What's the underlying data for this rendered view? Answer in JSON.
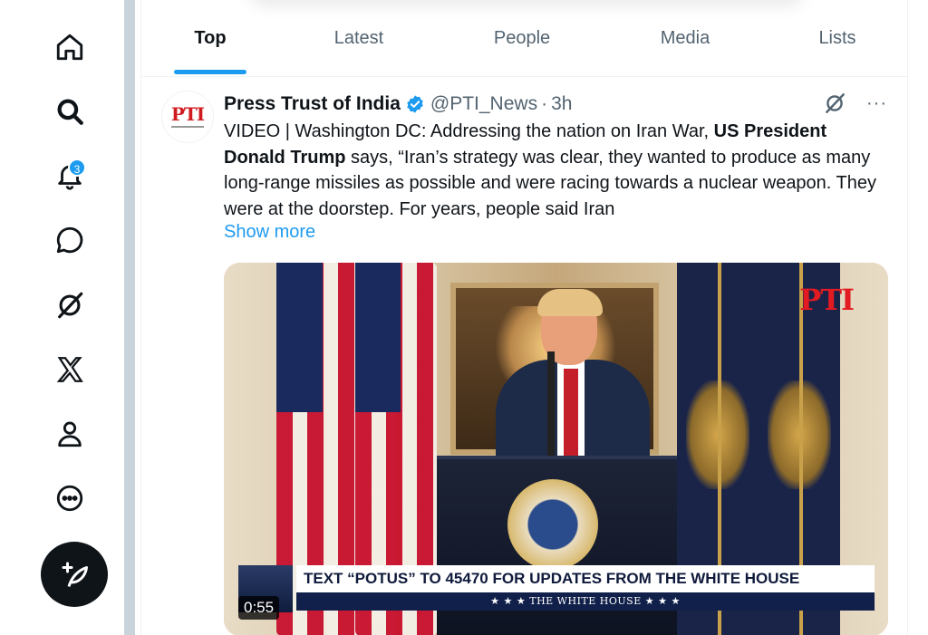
{
  "nav": {
    "notifications_badge": "3"
  },
  "tabs": [
    {
      "label": "Top"
    },
    {
      "label": "Latest"
    },
    {
      "label": "People"
    },
    {
      "label": "Media"
    },
    {
      "label": "Lists"
    }
  ],
  "tweet": {
    "author_name": "Press Trust of India",
    "handle": "@PTI_News",
    "separator": "·",
    "time": "3h",
    "more": "···",
    "avatar_text": "PTI",
    "text_part1": "VIDEO | Washington DC: Addressing the nation on Iran War, ",
    "text_bold": "US President Donald Trump",
    "text_part2": " says, “Iran’s strategy was clear, they wanted to produce as many long-range missiles as possible and were racing towards a nuclear weapon. They were at the doorstep. For years, people said Iran",
    "show_more": "Show more",
    "media": {
      "watermark": "PTI",
      "lower_third_top": "TEXT “POTUS” TO 45470 FOR UPDATES FROM THE WHITE HOUSE",
      "lower_third_bottom": "★ ★ ★   THE WHITE HOUSE   ★ ★ ★",
      "duration": "0:55"
    }
  },
  "colors": {
    "accent": "#1d9bf0",
    "text": "#0f1419",
    "muted": "#536471"
  }
}
